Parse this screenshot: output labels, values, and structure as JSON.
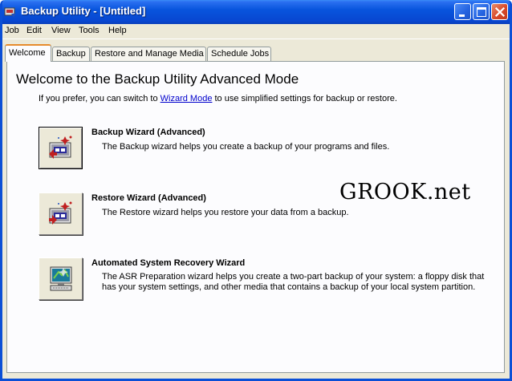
{
  "window": {
    "title": "Backup Utility - [Untitled]"
  },
  "menu": [
    "Job",
    "Edit",
    "View",
    "Tools",
    "Help"
  ],
  "tabs": [
    "Welcome",
    "Backup",
    "Restore and Manage Media",
    "Schedule Jobs"
  ],
  "welcome": {
    "heading": "Welcome to the Backup Utility Advanced Mode",
    "intro_before": "If you prefer, you can switch to ",
    "intro_link": "Wizard Mode",
    "intro_after": " to use simplified settings for backup or restore."
  },
  "wizards": [
    {
      "title": "Backup Wizard (Advanced)",
      "description": "The Backup wizard helps you create a backup of your programs and files.",
      "icon": "backup-wizard-icon"
    },
    {
      "title": "Restore Wizard (Advanced)",
      "description": "The Restore wizard helps you restore your data from a backup.",
      "icon": "restore-wizard-icon"
    },
    {
      "title": "Automated System Recovery Wizard",
      "description": "The ASR Preparation wizard helps you create a two-part backup of your system: a floppy disk that has your system settings, and other media that contains a backup of your local system partition.",
      "icon": "asr-wizard-icon"
    }
  ],
  "watermark": "GROOK.net",
  "colors": {
    "titlebar": "#0846d0",
    "link": "#0000cc",
    "active_tab_accent": "#e68b2c"
  }
}
